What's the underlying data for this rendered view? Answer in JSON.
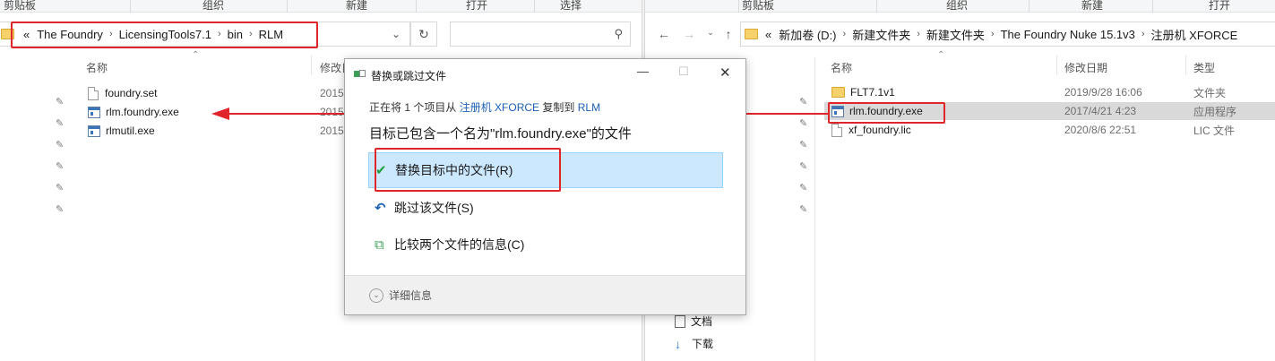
{
  "left_window": {
    "ribbon": [
      "剪贴板",
      "组织",
      "新建",
      "打开",
      "选择"
    ],
    "breadcrumb": [
      "The Foundry",
      "LicensingTools7.1",
      "bin",
      "RLM"
    ],
    "overflow": "«",
    "search_placeholder": "",
    "columns": {
      "name": "名称",
      "modified": "修改日"
    },
    "files": [
      {
        "name": "foundry.set",
        "date": "2015",
        "icon": "file"
      },
      {
        "name": "rlm.foundry.exe",
        "date": "2015",
        "icon": "exe"
      },
      {
        "name": "rlmutil.exe",
        "date": "2015",
        "icon": "exe"
      }
    ]
  },
  "right_window": {
    "ribbon": [
      "剪贴板",
      "组织",
      "新建",
      "打开"
    ],
    "overflow": "«",
    "breadcrumb": [
      "新加卷 (D:)",
      "新建文件夹",
      "新建文件夹",
      "The Foundry Nuke 15.1v3",
      "注册机 XFORCE"
    ],
    "columns": {
      "name": "名称",
      "modified": "修改日期",
      "type": "类型"
    },
    "files": [
      {
        "name": "FLT7.1v1",
        "date": "2019/9/28 16:06",
        "type": "文件夹",
        "icon": "folder"
      },
      {
        "name": "rlm.foundry.exe",
        "date": "2017/4/21 4:23",
        "type": "应用程序",
        "icon": "exe"
      },
      {
        "name": "xf_foundry.lic",
        "date": "2020/8/6 22:51",
        "type": "LIC 文件",
        "icon": "file"
      }
    ],
    "nav": [
      {
        "label": "文档",
        "icon": "document-icon"
      },
      {
        "label": "下载",
        "icon": "download-icon"
      }
    ]
  },
  "dialog": {
    "title": "替换或跳过文件",
    "line_prefix": "正在将 1 个项目从",
    "source": "注册机 XFORCE",
    "line_mid": "复制到",
    "dest": "RLM",
    "heading": "目标已包含一个名为\"rlm.foundry.exe\"的文件",
    "options": [
      {
        "label": "替换目标中的文件(R)",
        "icon": "checkmark-icon"
      },
      {
        "label": "跳过该文件(S)",
        "icon": "skip-icon"
      },
      {
        "label": "比较两个文件的信息(C)",
        "icon": "compare-icon"
      }
    ],
    "details": "详细信息"
  },
  "colors": {
    "highlight": "#e0262b",
    "selection": "#cce8ff",
    "link": "#1a5fb4"
  }
}
